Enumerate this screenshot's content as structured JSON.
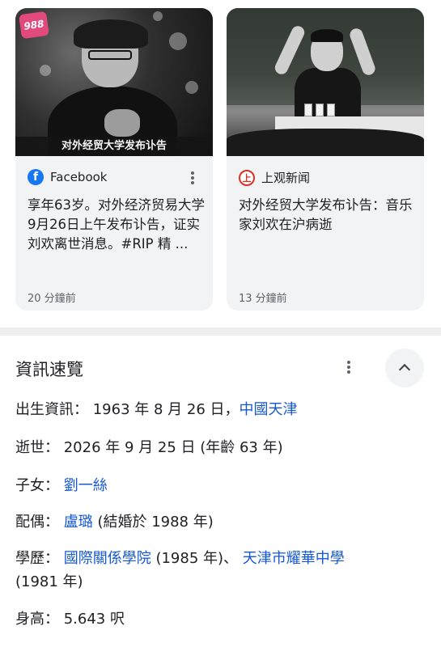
{
  "cards": [
    {
      "image_badge": "988",
      "image_caption": "对外经贸大学发布讣告",
      "source": "Facebook",
      "title": "享年63岁。对外经济贸易大学9月26日上午发布讣告，证实刘欢离世消息。#RIP 精 ...",
      "time": "20 分鐘前",
      "icon": "facebook-icon",
      "accent": "#1877f2"
    },
    {
      "source": "上观新闻",
      "title": "对外经贸大学发布讣告：音乐家刘欢在沪病逝",
      "time": "13 分鐘前",
      "icon": "shangguan-news-icon",
      "accent": "#d93025"
    }
  ],
  "info": {
    "title": "資訊速覽",
    "birth": {
      "label": "出生資訊：",
      "text": " 1963 年 8 月 26 日，",
      "link": "中國天津"
    },
    "death": {
      "label": "逝世：",
      "text": " 2026 年 9 月 25 日 (年齡 63 年)"
    },
    "children": {
      "label": "子女：",
      "link": "劉一絲"
    },
    "spouse": {
      "label": "配偶：",
      "link": "盧璐",
      "text": " (結婚於 1988 年)"
    },
    "education": {
      "label": "學歷：",
      "link1": "國際關係學院",
      "text1": " (1985 年)、 ",
      "link2": "天津市耀華中學",
      "text2": "(1981 年)"
    },
    "height": {
      "label": "身高：",
      "text": " 5.643 呎"
    }
  },
  "colors": {
    "link": "#1558d6",
    "card_bg": "#f1f3f4",
    "divider": "#eeeeee"
  }
}
